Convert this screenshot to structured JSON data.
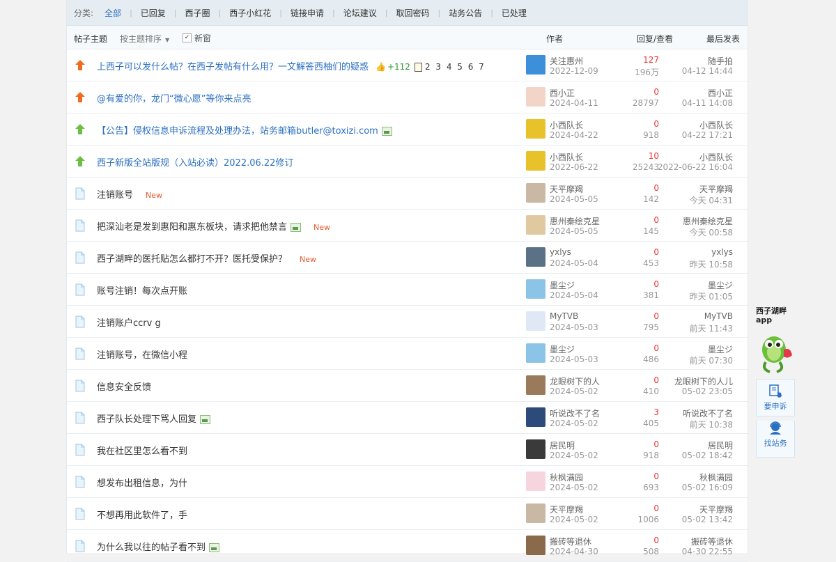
{
  "categories": {
    "label": "分类:",
    "items": [
      "全部",
      "已回复",
      "西子圈",
      "西子小红花",
      "链接申请",
      "论坛建议",
      "取回密码",
      "站务公告",
      "已处理"
    ]
  },
  "header": {
    "subject": "帖子主题",
    "sort": "按主题排序",
    "new_window": "新窗",
    "author": "作者",
    "replies_views": "回复/查看",
    "last_post": "最后发表"
  },
  "threads": [
    {
      "icon": "hot-orange-icon",
      "title": "上西子可以发什么帖？在西子发帖有什么用？一文解答西柚们的疑惑",
      "title_color": "blue",
      "likes": "+112",
      "pages": "2 3 4 5 6 7",
      "author": "关注惠州",
      "date": "2022-12-09",
      "replies": "127",
      "views": "196万",
      "last_user": "随手拍",
      "last_time": "04-12 14:44",
      "avatar_color": "#3c8fd8"
    },
    {
      "icon": "hot-orange-icon",
      "title": "@有爱的你，龙门“微心愿”等你来点亮",
      "title_color": "blue",
      "author": "西小正",
      "date": "2024-04-11",
      "replies": "0",
      "views": "28797",
      "last_user": "西小正",
      "last_time": "04-11 14:08",
      "avatar_color": "#f2d5c8"
    },
    {
      "icon": "pin-green-icon",
      "title": "【公告】侵权信息申诉流程及处理办法，站务邮箱butler@toxizi.com",
      "title_color": "blue",
      "has_image": true,
      "author": "小西队长",
      "date": "2024-04-22",
      "replies": "0",
      "views": "918",
      "last_user": "小西队长",
      "last_time": "04-22 17:21",
      "avatar_color": "#e8c22a"
    },
    {
      "icon": "pin-green-icon",
      "title": "西子新版全站版规（入站必读）2022.06.22修订",
      "title_color": "blue",
      "author": "小西队长",
      "date": "2022-06-22",
      "replies": "10",
      "views": "25243",
      "last_user": "小西队长",
      "last_time": "2022-06-22 16:04",
      "avatar_color": "#e8c22a"
    },
    {
      "icon": "doc-icon",
      "title": "注销账号",
      "new": "New",
      "author": "天平摩羯",
      "date": "2024-05-05",
      "replies": "0",
      "views": "142",
      "last_user": "天平摩羯",
      "last_time": "今天 04:31",
      "avatar_color": "#c8b8a4"
    },
    {
      "icon": "doc-icon",
      "title": "把深汕老是发到惠阳和惠东板块，请求把他禁言",
      "has_image": true,
      "new": "New",
      "author": "惠州秦绘克星",
      "date": "2024-05-05",
      "replies": "0",
      "views": "145",
      "last_user": "惠州秦绘克星",
      "last_time": "今天 00:58",
      "avatar_color": "#e0c8a0"
    },
    {
      "icon": "doc-icon",
      "title": "西子湖畔的医托贴怎么都打不开？医托受保护？",
      "new": "New",
      "author": "yxlys",
      "date": "2024-05-04",
      "replies": "0",
      "views": "453",
      "last_user": "yxlys",
      "last_time": "昨天 10:58",
      "avatar_color": "#5a7186"
    },
    {
      "icon": "doc-icon",
      "title": "账号注销！每次点开账",
      "author": "墨尘ジ",
      "date": "2024-05-04",
      "replies": "0",
      "views": "381",
      "last_user": "墨尘ジ",
      "last_time": "昨天 01:05",
      "avatar_color": "#8cc4e8"
    },
    {
      "icon": "doc-icon",
      "title": "注销账户ccrv g",
      "author": "MyTVB",
      "date": "2024-05-03",
      "replies": "0",
      "views": "795",
      "last_user": "MyTVB",
      "last_time": "前天 11:43",
      "avatar_color": "#dfe8f4"
    },
    {
      "icon": "doc-icon",
      "title": "注销账号，在微信小程",
      "author": "墨尘ジ",
      "date": "2024-05-03",
      "replies": "0",
      "views": "486",
      "last_user": "墨尘ジ",
      "last_time": "前天 07:30",
      "avatar_color": "#8cc4e8"
    },
    {
      "icon": "doc-icon",
      "title": "信息安全反馈",
      "author": "龙眼树下的人",
      "date": "2024-05-02",
      "replies": "0",
      "views": "410",
      "last_user": "龙眼树下的人儿",
      "last_time": "05-02 23:05",
      "avatar_color": "#9a7a5a"
    },
    {
      "icon": "doc-icon",
      "title": "西子队长处理下骂人回复",
      "has_image": true,
      "author": "听说改不了名",
      "date": "2024-05-02",
      "replies": "3",
      "views": "405",
      "last_user": "听说改不了名",
      "last_time": "前天 10:38",
      "avatar_color": "#2c4a7a"
    },
    {
      "icon": "doc-icon",
      "title": "我在社区里怎么看不到",
      "author": "居民明",
      "date": "2024-05-02",
      "replies": "0",
      "views": "918",
      "last_user": "居民明",
      "last_time": "05-02 18:42",
      "avatar_color": "#3a3a3a"
    },
    {
      "icon": "doc-icon",
      "title": "想发布出租信息，为什",
      "author": "秋枫满园",
      "date": "2024-05-02",
      "replies": "0",
      "views": "693",
      "last_user": "秋枫满园",
      "last_time": "05-02 16:09",
      "avatar_color": "#f6d6dc"
    },
    {
      "icon": "doc-icon",
      "title": "不想再用此软件了，手",
      "author": "天平摩羯",
      "date": "2024-05-02",
      "replies": "0",
      "views": "1006",
      "last_user": "天平摩羯",
      "last_time": "05-02 13:42",
      "avatar_color": "#c8b8a4"
    },
    {
      "icon": "doc-icon",
      "title": "为什么我以往的帖子看不到",
      "has_image": true,
      "author": "搬砖等退休",
      "date": "2024-04-30",
      "replies": "0",
      "views": "508",
      "last_user": "搬砖等退休",
      "last_time": "04-30 22:55",
      "avatar_color": "#8a6a4a"
    }
  ],
  "sidebar": {
    "app_title_line1": "西子湖畔",
    "app_title_line2": "app",
    "complaint": "要申诉",
    "service": "找站务"
  }
}
